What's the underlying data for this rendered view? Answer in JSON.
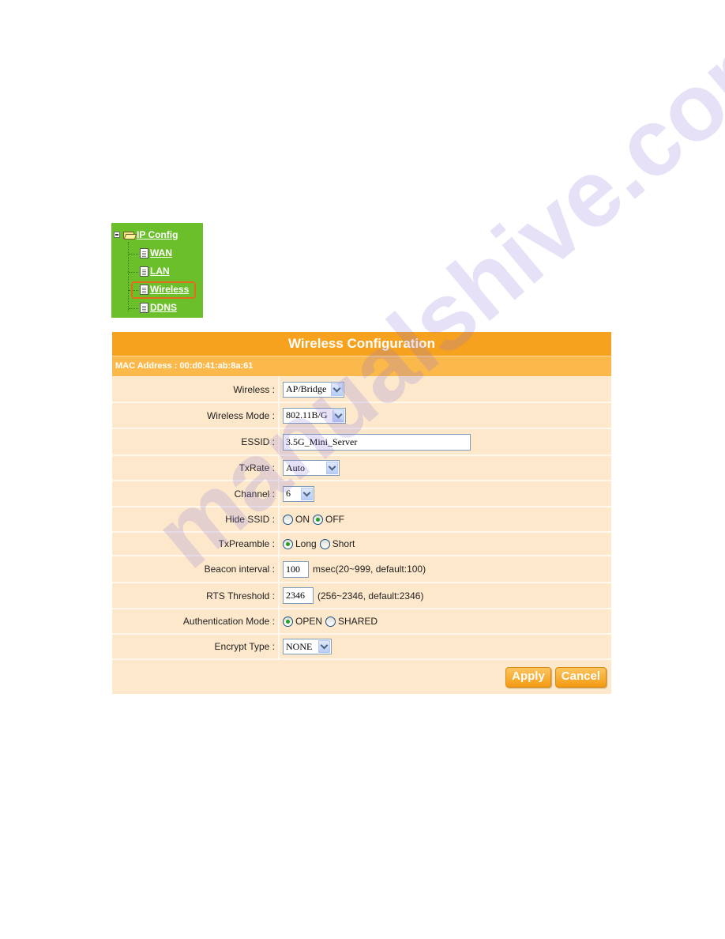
{
  "tree": {
    "root_label": "IP Config",
    "items": [
      {
        "label": "WAN",
        "selected": false
      },
      {
        "label": "LAN",
        "selected": false
      },
      {
        "label": "Wireless",
        "selected": true
      },
      {
        "label": "DDNS",
        "selected": false
      }
    ]
  },
  "panel": {
    "title": "Wireless Configuration",
    "mac_address": "MAC Address : 00:d0:41:ab:8a:61",
    "fields": {
      "wireless": {
        "label": "Wireless :",
        "value": "AP/Bridge"
      },
      "wireless_mode": {
        "label": "Wireless Mode :",
        "value": "802.11B/G"
      },
      "essid": {
        "label": "ESSID :",
        "value": "3.5G_Mini_Server"
      },
      "txrate": {
        "label": "TxRate :",
        "value": "Auto"
      },
      "channel": {
        "label": "Channel :",
        "value": "6"
      },
      "hide_ssid": {
        "label": "Hide SSID :",
        "options": [
          "ON",
          "OFF"
        ],
        "selected": "OFF"
      },
      "txpreamble": {
        "label": "TxPreamble :",
        "options": [
          "Long",
          "Short"
        ],
        "selected": "Long"
      },
      "beacon_interval": {
        "label": "Beacon interval :",
        "value": "100",
        "hint": "msec(20~999, default:100)"
      },
      "rts_threshold": {
        "label": "RTS Threshold :",
        "value": "2346",
        "hint": "(256~2346, default:2346)"
      },
      "auth_mode": {
        "label": "Authentication Mode :",
        "options": [
          "OPEN",
          "SHARED"
        ],
        "selected": "OPEN"
      },
      "encrypt_type": {
        "label": "Encrypt Type :",
        "value": "NONE"
      }
    },
    "buttons": {
      "apply": "Apply",
      "cancel": "Cancel"
    }
  },
  "watermark": "manualshive.com",
  "colors": {
    "tree_bg": "#6bbf2a",
    "header": "#f7a21e",
    "mac_row": "#fbb84b",
    "row_bg": "#fde8cc",
    "highlight": "#e36c1c"
  }
}
